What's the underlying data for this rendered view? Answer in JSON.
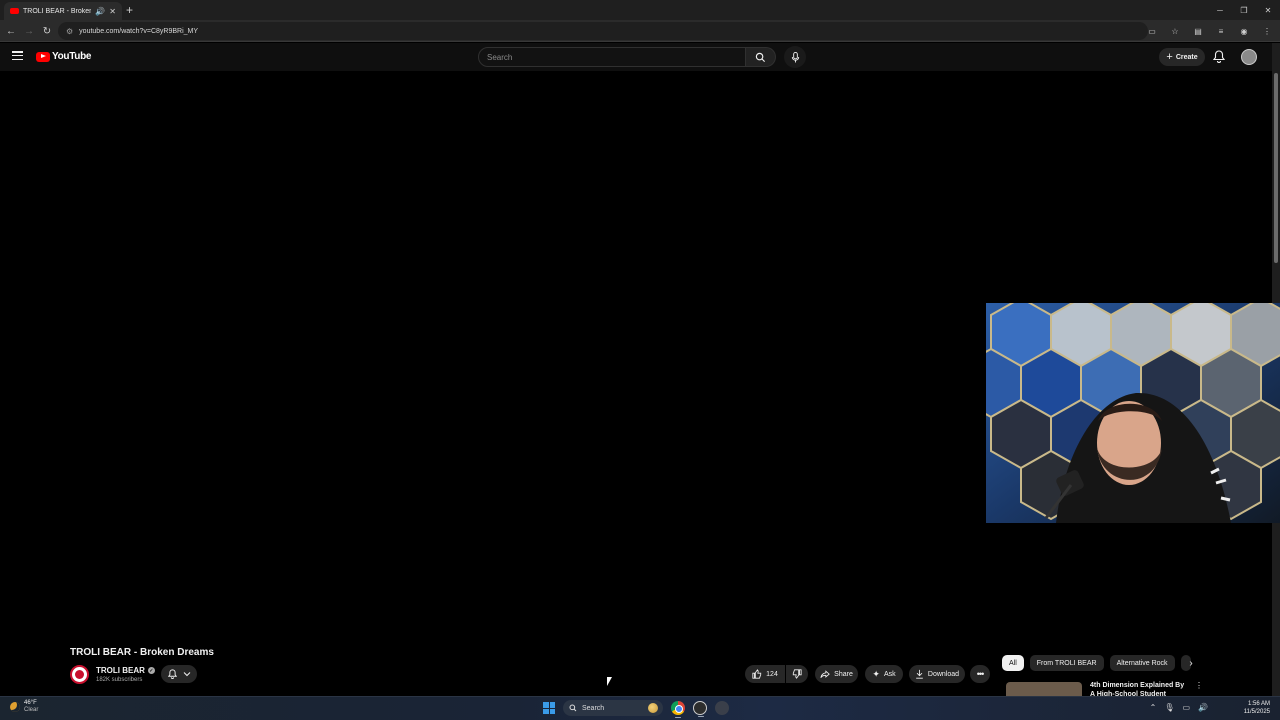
{
  "browser": {
    "tab_title": "TROLI BEAR - Broken Dreams",
    "new_tab_icon": "+",
    "url": "youtube.com/watch?v=C8yR9BRi_MY"
  },
  "youtube": {
    "logo_text": "YouTube",
    "search_placeholder": "Search",
    "create_label": "Create"
  },
  "video": {
    "title": "TROLI BEAR - Broken Dreams",
    "channel_name": "TROLI BEAR",
    "subscribers": "182K subscribers",
    "like_count": "124",
    "share_label": "Share",
    "ask_label": "Ask",
    "download_label": "Download"
  },
  "chips": [
    "All",
    "From TROLI BEAR",
    "Alternative Rock"
  ],
  "recommendation": {
    "title": "4th Dimension Explained By A High-School Student"
  },
  "taskbar": {
    "temperature": "46°F",
    "condition": "Clear",
    "search_label": "Search",
    "time": "1:56 AM",
    "date": "11/5/2025"
  }
}
